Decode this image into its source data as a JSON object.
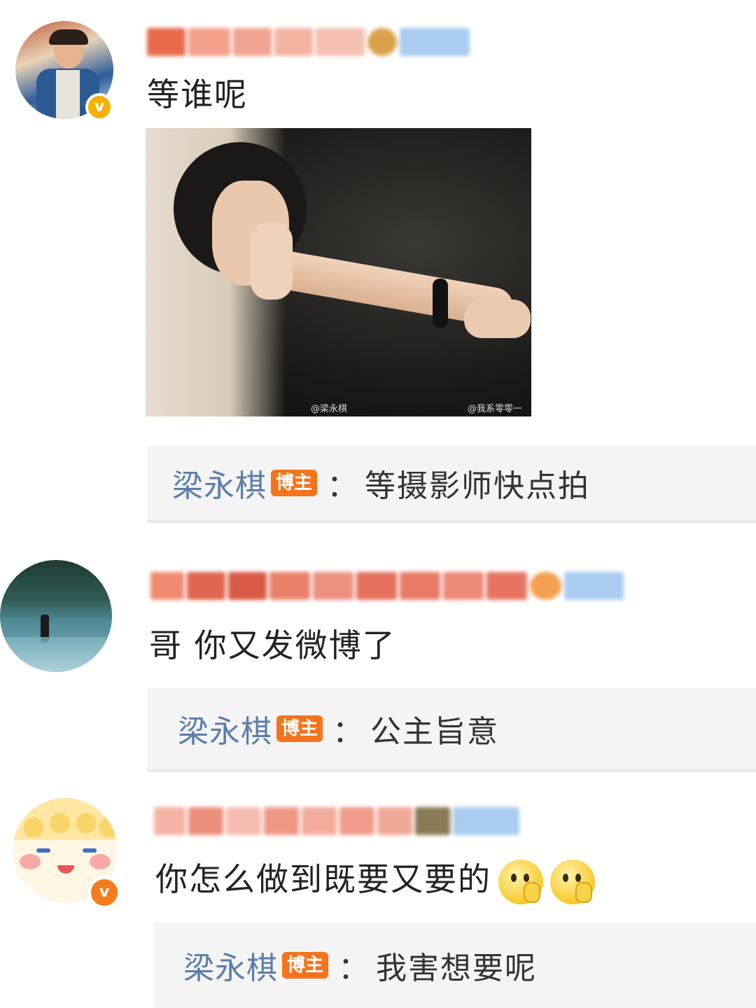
{
  "comments": [
    {
      "text": "等谁呢",
      "reply": {
        "author": "梁永棋",
        "badge": "博主",
        "colon": "：",
        "text": "等摄影师快点拍"
      },
      "photo": {
        "watermark_left": "@梁永棋",
        "watermark_right": "@我系零零一"
      },
      "verified_color": "#f5b000"
    },
    {
      "text": "哥 你又发微博了",
      "reply": {
        "author": "梁永棋",
        "badge": "博主",
        "colon": "：",
        "text": "公主旨意"
      }
    },
    {
      "text": "你怎么做到既要又要的",
      "emoji": [
        "thinking-face-icon",
        "thinking-face-icon"
      ],
      "reply": {
        "author": "梁永棋",
        "badge": "博主",
        "colon": "：",
        "text": "我害想要呢"
      },
      "verified_color": "#f57c1b"
    }
  ],
  "colors": {
    "reply_author": "#5b7ea8",
    "badge": "#f5731b",
    "reply_bg": "#f4f4f4"
  }
}
